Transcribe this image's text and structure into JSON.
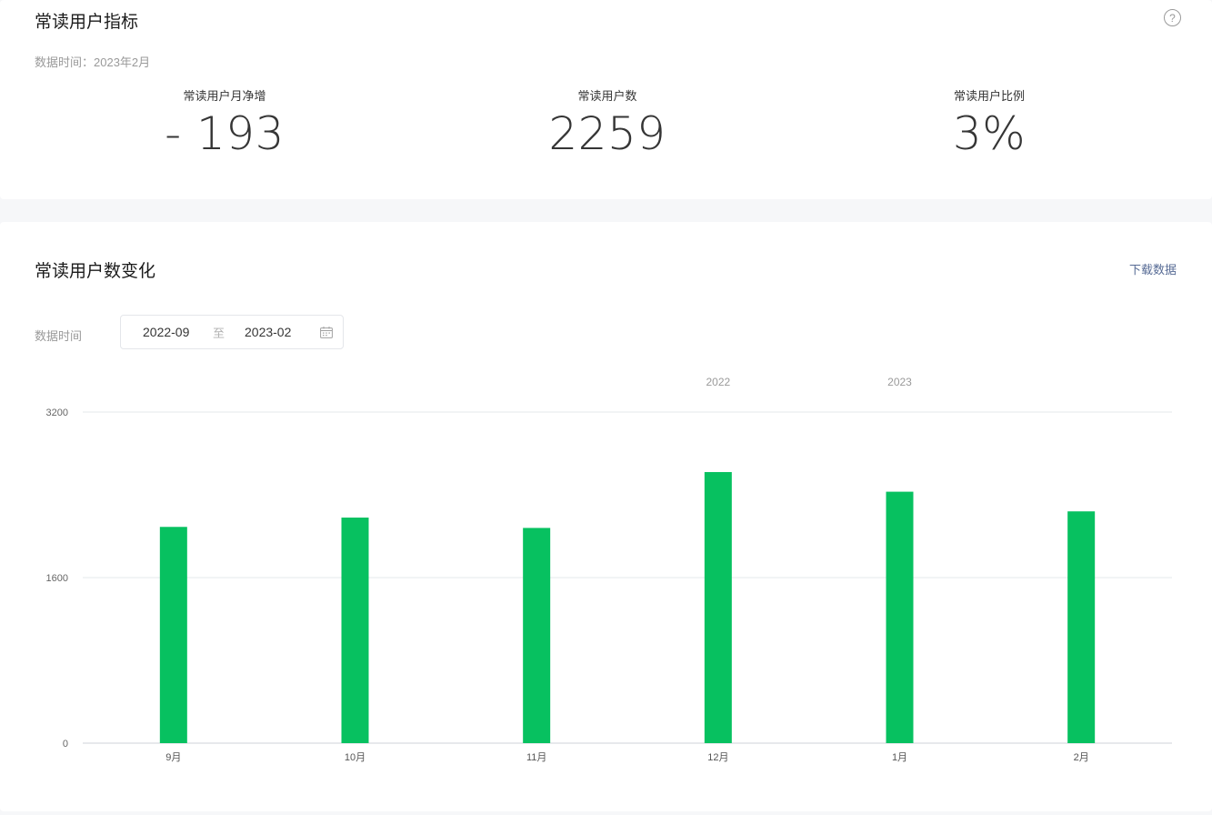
{
  "metrics_card": {
    "title": "常读用户指标",
    "data_time": "数据时间：2023年2月",
    "help_icon": "question-circle-icon",
    "metrics": [
      {
        "label": "常读用户月净增",
        "value": "- 193"
      },
      {
        "label": "常读用户数",
        "value": "2259"
      },
      {
        "label": "常读用户比例",
        "value": "3%"
      }
    ]
  },
  "trend_card": {
    "title": "常读用户数变化",
    "download_label": "下载数据",
    "filter_label": "数据时间",
    "date_range": {
      "start": "2022-09",
      "separator": "至",
      "end": "2023-02"
    },
    "calendar_icon": "calendar-icon"
  },
  "chart_data": {
    "type": "bar",
    "categories": [
      "9月",
      "10月",
      "11月",
      "12月",
      "1月",
      "2月"
    ],
    "year_labels": [
      {
        "label": "2022",
        "at_index": 3
      },
      {
        "label": "2023",
        "at_index": 4
      }
    ],
    "values": [
      2090,
      2180,
      2080,
      2620,
      2430,
      2240
    ],
    "yticks": [
      0,
      1600,
      3200
    ],
    "ylim": [
      0,
      3200
    ],
    "bar_color": "#07c160",
    "grid": true
  }
}
